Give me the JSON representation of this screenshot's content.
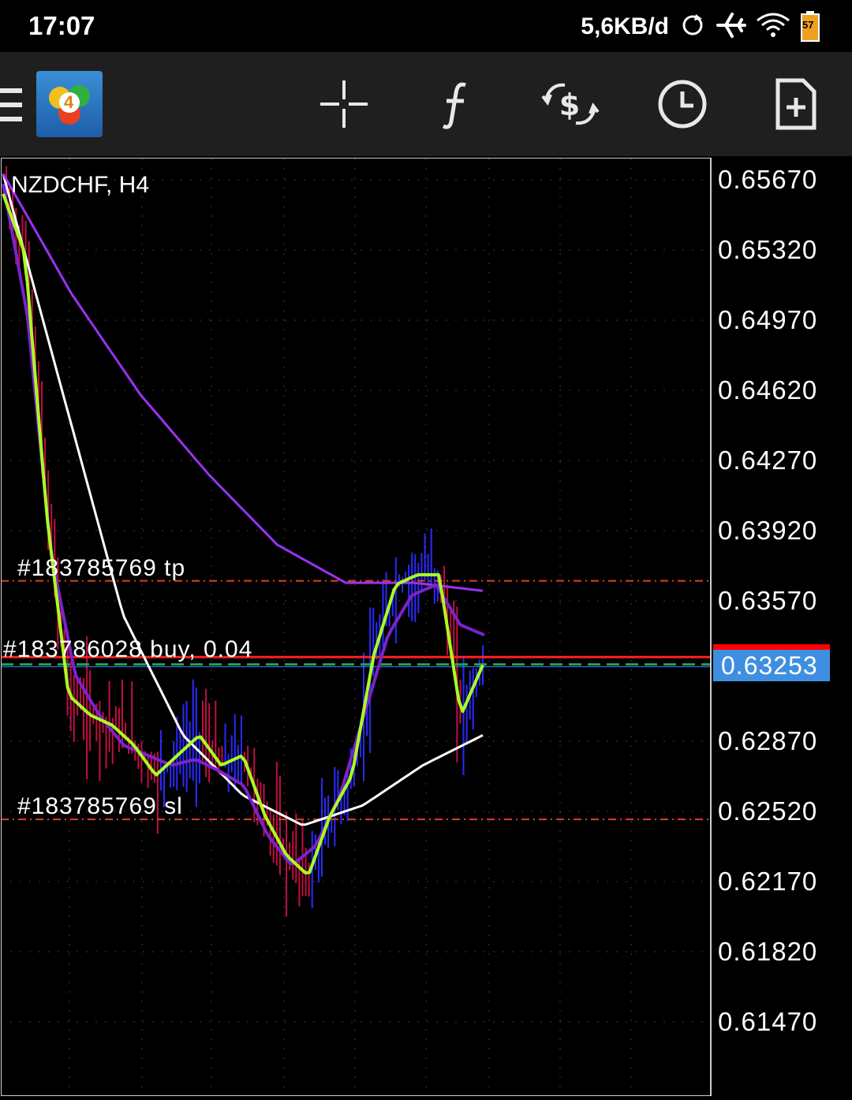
{
  "status_bar": {
    "time": "17:07",
    "net_speed": "5,6KB/d",
    "battery": "57",
    "icons": [
      "sync-icon",
      "airplane-icon",
      "wifi-icon",
      "battery-icon"
    ]
  },
  "toolbar": {
    "icons": [
      "menu-icon",
      "metatrader4-logo-icon",
      "crosshair-icon",
      "indicators-icon",
      "trade-icon",
      "timeframe-icon",
      "new-order-icon"
    ],
    "logo_text": "4"
  },
  "chart": {
    "symbol": "NZDCHF, H4",
    "current_price": "0.63253",
    "order_labels": {
      "tp": "#183785769 tp",
      "buy": "#183786028 buy, 0.04",
      "sl": "#183785769 sl"
    },
    "colors": {
      "sma_fast": "#aaff22",
      "sma_mid": "#7b22cc",
      "sma_slow": "#9932ee",
      "sma_white": "#ffffff",
      "bull": "#2a2aff",
      "bear": "#c01040",
      "order_line": "#e04020",
      "bid_line": "#ff0000",
      "price_tag": "#3f8fe0"
    }
  },
  "chart_data": {
    "type": "line",
    "title": "NZDCHF, H4",
    "ylim": [
      0.613,
      0.6573
    ],
    "y_ticks": [
      "0.65670",
      "0.65320",
      "0.64970",
      "0.64620",
      "0.64270",
      "0.63920",
      "0.63570",
      "0.62870",
      "0.62520",
      "0.62170",
      "0.61820",
      "0.61470"
    ],
    "horizontal_lines": [
      {
        "label": "#183785769 tp",
        "value": 0.6367
      },
      {
        "label": "#183786028 buy, 0.04",
        "value": 0.6329
      },
      {
        "label": "#183785769 sl",
        "value": 0.6248
      },
      {
        "label": "bid",
        "value": 0.63253
      }
    ],
    "series": [
      {
        "values": [
          0.656,
          0.653,
          0.64,
          0.631,
          0.63,
          0.6295,
          0.6285,
          0.627,
          0.628,
          0.629,
          0.6275,
          0.628,
          0.625,
          0.623,
          0.622,
          0.625,
          0.627,
          0.633,
          0.6365,
          0.637,
          0.637,
          0.63,
          0.6325
        ]
      },
      {
        "values": [
          0.6565,
          0.65,
          0.638,
          0.632,
          0.63,
          0.6285,
          0.628,
          0.6275,
          0.6278,
          0.6272,
          0.6265,
          0.624,
          0.6225,
          0.6235,
          0.626,
          0.63,
          0.634,
          0.636,
          0.6365,
          0.6345,
          0.634
        ]
      },
      {
        "values": [
          0.657,
          0.651,
          0.646,
          0.642,
          0.6385,
          0.6366,
          0.6366,
          0.6362
        ]
      },
      {
        "values": [
          0.657,
          0.646,
          0.635,
          0.629,
          0.626,
          0.6245,
          0.6255,
          0.6275,
          0.629
        ]
      }
    ]
  }
}
